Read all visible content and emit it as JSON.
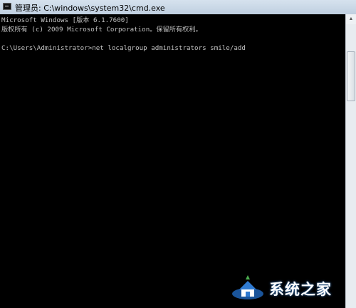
{
  "window": {
    "title": "管理员: C:\\windows\\system32\\cmd.exe",
    "controls": {
      "minimize": "–",
      "maximize": "□",
      "close": "✕"
    }
  },
  "console": {
    "lines": [
      "Microsoft Windows [版本 6.1.7600]",
      "版权所有 (c) 2009 Microsoft Corporation。保留所有权利。",
      "",
      "C:\\Users\\Administrator>net localgroup administrators smile/add"
    ]
  },
  "scrollbar": {
    "up_arrow": "▲"
  },
  "watermark": {
    "text": "系统之家"
  },
  "colors": {
    "console_bg": "#000000",
    "console_text": "#c0c0c0",
    "titlebar": "#c9d6e4"
  },
  "icons": {
    "title_icon": "cmd-icon",
    "watermark_logo": "house-logo-icon"
  }
}
